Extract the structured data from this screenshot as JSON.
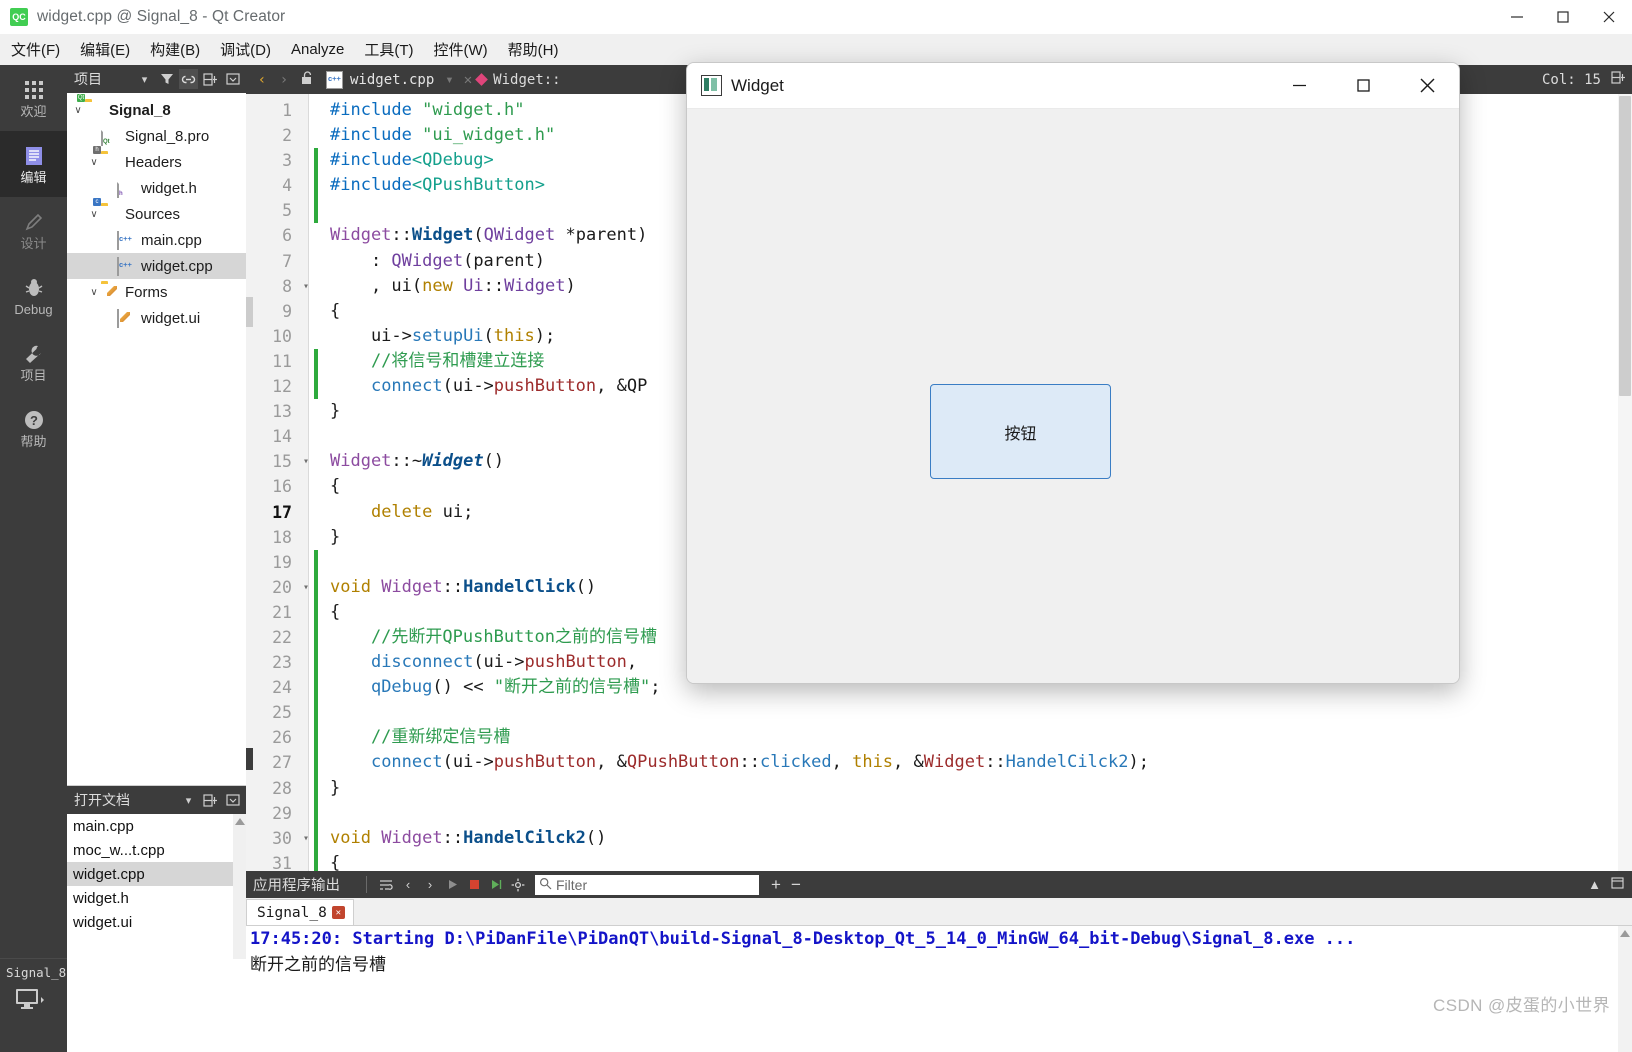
{
  "window": {
    "title": "widget.cpp @ Signal_8 - Qt Creator",
    "app_icon": "qt-logo-icon",
    "minimize_label": "—",
    "maximize_label": "☐",
    "close_label": "✕"
  },
  "menubar": {
    "items": [
      {
        "label": "文件(F)",
        "name": "menu-file"
      },
      {
        "label": "编辑(E)",
        "name": "menu-edit"
      },
      {
        "label": "构建(B)",
        "name": "menu-build"
      },
      {
        "label": "调试(D)",
        "name": "menu-debug"
      },
      {
        "label": "Analyze",
        "name": "menu-analyze"
      },
      {
        "label": "工具(T)",
        "name": "menu-tools"
      },
      {
        "label": "控件(W)",
        "name": "menu-window"
      },
      {
        "label": "帮助(H)",
        "name": "menu-help"
      }
    ]
  },
  "modebar": {
    "items": [
      {
        "label": "欢迎",
        "icon": "grid-icon",
        "active": false
      },
      {
        "label": "编辑",
        "icon": "document-icon",
        "active": true
      },
      {
        "label": "设计",
        "icon": "pencil-icon",
        "active": false
      },
      {
        "label": "Debug",
        "icon": "bug-icon",
        "active": false
      },
      {
        "label": "项目",
        "icon": "wrench-icon",
        "active": false
      },
      {
        "label": "帮助",
        "icon": "question-icon",
        "active": false
      }
    ],
    "kit_name": "Signal_8",
    "kit_icon": "desktop-icon"
  },
  "project_panel": {
    "title": "项目",
    "tools": [
      "chevron-down-icon",
      "filter-icon",
      "link-icon",
      "split-icon",
      "collapse-icon"
    ],
    "tree": [
      {
        "label": "Signal_8",
        "depth": 0,
        "arrow": "∨",
        "icon": "qt-project-folder-icon",
        "bold": true,
        "selected": false
      },
      {
        "label": "Signal_8.pro",
        "depth": 1,
        "arrow": "",
        "icon": "pro-file-icon",
        "bold": false,
        "selected": false
      },
      {
        "label": "Headers",
        "depth": 1,
        "arrow": "∨",
        "icon": "headers-folder-icon",
        "bold": false,
        "selected": false
      },
      {
        "label": "widget.h",
        "depth": 2,
        "arrow": "",
        "icon": "header-file-icon",
        "bold": false,
        "selected": false
      },
      {
        "label": "Sources",
        "depth": 1,
        "arrow": "∨",
        "icon": "sources-folder-icon",
        "bold": false,
        "selected": false
      },
      {
        "label": "main.cpp",
        "depth": 2,
        "arrow": "",
        "icon": "cpp-file-icon",
        "bold": false,
        "selected": false
      },
      {
        "label": "widget.cpp",
        "depth": 2,
        "arrow": "",
        "icon": "cpp-file-icon",
        "bold": false,
        "selected": true
      },
      {
        "label": "Forms",
        "depth": 1,
        "arrow": "∨",
        "icon": "forms-folder-icon",
        "bold": false,
        "selected": false
      },
      {
        "label": "widget.ui",
        "depth": 2,
        "arrow": "",
        "icon": "ui-file-icon",
        "bold": false,
        "selected": false
      }
    ]
  },
  "open_documents": {
    "title": "打开文档",
    "tools": [
      "chevron-down-icon",
      "split-icon",
      "collapse-icon"
    ],
    "items": [
      {
        "label": "main.cpp",
        "selected": false
      },
      {
        "label": "moc_w...t.cpp",
        "selected": false
      },
      {
        "label": "widget.cpp",
        "selected": true
      },
      {
        "label": "widget.h",
        "selected": false
      },
      {
        "label": "widget.ui",
        "selected": false
      }
    ]
  },
  "editor_toolbar": {
    "back_label": "‹",
    "forward_label": "›",
    "lock_icon": "unlocked-icon",
    "file_icon": "cpp-file-icon",
    "filename": "widget.cpp",
    "dropdown_label": "▾",
    "close_label": "✕",
    "symbol_icon": "class-diamond-icon",
    "symbol_name": "Widget::",
    "column_status": "Col: 15",
    "split_icon": "split-icon"
  },
  "code": {
    "lines": [
      {
        "n": "1",
        "fold": "",
        "changed": false,
        "cur": false,
        "tokens": [
          {
            "t": "#include ",
            "c": "k-pre"
          },
          {
            "t": "\"widget.h\"",
            "c": "k-str"
          }
        ]
      },
      {
        "n": "2",
        "fold": "",
        "changed": false,
        "cur": false,
        "tokens": [
          {
            "t": "#include ",
            "c": "k-pre"
          },
          {
            "t": "\"ui_widget.h\"",
            "c": "k-str"
          }
        ]
      },
      {
        "n": "3",
        "fold": "",
        "changed": true,
        "cur": false,
        "tokens": [
          {
            "t": "#include",
            "c": "k-pre"
          },
          {
            "t": "<QDebug>",
            "c": "k-hdr"
          }
        ]
      },
      {
        "n": "4",
        "fold": "",
        "changed": true,
        "cur": false,
        "tokens": [
          {
            "t": "#include",
            "c": "k-pre"
          },
          {
            "t": "<QPushButton>",
            "c": "k-hdr"
          }
        ]
      },
      {
        "n": "5",
        "fold": "",
        "changed": true,
        "cur": false,
        "tokens": [
          {
            "t": "",
            "c": "k-plain"
          }
        ]
      },
      {
        "n": "6",
        "fold": "",
        "changed": false,
        "cur": false,
        "tokens": [
          {
            "t": "Widget",
            "c": "k-cls"
          },
          {
            "t": "::",
            "c": "k-punc"
          },
          {
            "t": "Widget",
            "c": "k-fn"
          },
          {
            "t": "(",
            "c": "k-punc"
          },
          {
            "t": "QWidget",
            "c": "k-typ"
          },
          {
            "t": " *parent)",
            "c": "k-plain"
          }
        ]
      },
      {
        "n": "7",
        "fold": "",
        "changed": false,
        "cur": false,
        "tokens": [
          {
            "t": "    : ",
            "c": "k-plain"
          },
          {
            "t": "QWidget",
            "c": "k-typ"
          },
          {
            "t": "(parent)",
            "c": "k-plain"
          }
        ]
      },
      {
        "n": "8",
        "fold": "▾",
        "changed": false,
        "cur": false,
        "tokens": [
          {
            "t": "    , ",
            "c": "k-plain"
          },
          {
            "t": "ui",
            "c": "k-plain"
          },
          {
            "t": "(",
            "c": "k-punc"
          },
          {
            "t": "new ",
            "c": "k-kw"
          },
          {
            "t": "Ui",
            "c": "k-typ"
          },
          {
            "t": "::",
            "c": "k-punc"
          },
          {
            "t": "Widget",
            "c": "k-typ"
          },
          {
            "t": ")",
            "c": "k-punc"
          }
        ]
      },
      {
        "n": "9",
        "fold": "",
        "changed": false,
        "cur": false,
        "tokens": [
          {
            "t": "{",
            "c": "k-punc"
          }
        ]
      },
      {
        "n": "10",
        "fold": "",
        "changed": false,
        "cur": false,
        "tokens": [
          {
            "t": "    ui->",
            "c": "k-plain"
          },
          {
            "t": "setupUi",
            "c": "k-call"
          },
          {
            "t": "(",
            "c": "k-punc"
          },
          {
            "t": "this",
            "c": "k-kw"
          },
          {
            "t": ");",
            "c": "k-punc"
          }
        ]
      },
      {
        "n": "11",
        "fold": "",
        "changed": true,
        "cur": false,
        "tokens": [
          {
            "t": "    //将信号和槽建立连接",
            "c": "k-cmt"
          }
        ]
      },
      {
        "n": "12",
        "fold": "",
        "changed": true,
        "cur": false,
        "tokens": [
          {
            "t": "    ",
            "c": "k-plain"
          },
          {
            "t": "connect",
            "c": "k-call"
          },
          {
            "t": "(ui->",
            "c": "k-punc"
          },
          {
            "t": "pushButton",
            "c": "k-mem"
          },
          {
            "t": ", &QP",
            "c": "k-punc"
          }
        ]
      },
      {
        "n": "13",
        "fold": "",
        "changed": false,
        "cur": false,
        "tokens": [
          {
            "t": "}",
            "c": "k-punc"
          }
        ]
      },
      {
        "n": "14",
        "fold": "",
        "changed": false,
        "cur": false,
        "tokens": [
          {
            "t": "",
            "c": "k-plain"
          }
        ]
      },
      {
        "n": "15",
        "fold": "▾",
        "changed": false,
        "cur": false,
        "tokens": [
          {
            "t": "Widget",
            "c": "k-cls"
          },
          {
            "t": "::~",
            "c": "k-punc"
          },
          {
            "t": "Widget",
            "c": "k-fnit"
          },
          {
            "t": "()",
            "c": "k-punc"
          }
        ]
      },
      {
        "n": "16",
        "fold": "",
        "changed": false,
        "cur": false,
        "tokens": [
          {
            "t": "{",
            "c": "k-punc"
          }
        ]
      },
      {
        "n": "17",
        "fold": "",
        "changed": false,
        "cur": true,
        "tokens": [
          {
            "t": "    ",
            "c": "k-plain"
          },
          {
            "t": "delete ",
            "c": "k-kw"
          },
          {
            "t": "ui",
            "c": "k-plain"
          },
          {
            "t": ";",
            "c": "k-punc"
          }
        ]
      },
      {
        "n": "18",
        "fold": "",
        "changed": false,
        "cur": false,
        "tokens": [
          {
            "t": "}",
            "c": "k-punc"
          }
        ]
      },
      {
        "n": "19",
        "fold": "",
        "changed": true,
        "cur": false,
        "tokens": [
          {
            "t": "",
            "c": "k-plain"
          }
        ]
      },
      {
        "n": "20",
        "fold": "▾",
        "changed": true,
        "cur": false,
        "tokens": [
          {
            "t": "void ",
            "c": "k-kw"
          },
          {
            "t": "Widget",
            "c": "k-cls"
          },
          {
            "t": "::",
            "c": "k-punc"
          },
          {
            "t": "HandelClick",
            "c": "k-fn"
          },
          {
            "t": "()",
            "c": "k-punc"
          }
        ]
      },
      {
        "n": "21",
        "fold": "",
        "changed": true,
        "cur": false,
        "tokens": [
          {
            "t": "{",
            "c": "k-punc"
          }
        ]
      },
      {
        "n": "22",
        "fold": "",
        "changed": true,
        "cur": false,
        "tokens": [
          {
            "t": "    //先断开QPushButton之前的信号槽",
            "c": "k-cmt"
          }
        ]
      },
      {
        "n": "23",
        "fold": "",
        "changed": true,
        "cur": false,
        "tokens": [
          {
            "t": "    ",
            "c": "k-plain"
          },
          {
            "t": "disconnect",
            "c": "k-call"
          },
          {
            "t": "(ui->",
            "c": "k-punc"
          },
          {
            "t": "pushButton",
            "c": "k-mem"
          },
          {
            "t": ", ",
            "c": "k-punc"
          }
        ]
      },
      {
        "n": "24",
        "fold": "",
        "changed": true,
        "cur": false,
        "tokens": [
          {
            "t": "    ",
            "c": "k-plain"
          },
          {
            "t": "qDebug",
            "c": "k-call"
          },
          {
            "t": "() ",
            "c": "k-punc"
          },
          {
            "t": "<< ",
            "c": "k-punc"
          },
          {
            "t": "\"断开之前的信号槽\"",
            "c": "k-str"
          },
          {
            "t": ";",
            "c": "k-punc"
          }
        ]
      },
      {
        "n": "25",
        "fold": "",
        "changed": true,
        "cur": false,
        "tokens": [
          {
            "t": "",
            "c": "k-plain"
          }
        ]
      },
      {
        "n": "26",
        "fold": "",
        "changed": true,
        "cur": false,
        "tokens": [
          {
            "t": "    //重新绑定信号槽",
            "c": "k-cmt"
          }
        ]
      },
      {
        "n": "27",
        "fold": "",
        "changed": true,
        "cur": false,
        "tokens": [
          {
            "t": "    ",
            "c": "k-plain"
          },
          {
            "t": "connect",
            "c": "k-call"
          },
          {
            "t": "(ui->",
            "c": "k-punc"
          },
          {
            "t": "pushButton",
            "c": "k-mem"
          },
          {
            "t": ", &",
            "c": "k-punc"
          },
          {
            "t": "QPushButton",
            "c": "k-mem"
          },
          {
            "t": "::",
            "c": "k-punc"
          },
          {
            "t": "clicked",
            "c": "k-call"
          },
          {
            "t": ", ",
            "c": "k-punc"
          },
          {
            "t": "this",
            "c": "k-kw"
          },
          {
            "t": ", &",
            "c": "k-punc"
          },
          {
            "t": "Widget",
            "c": "k-mem"
          },
          {
            "t": "::",
            "c": "k-punc"
          },
          {
            "t": "HandelCilck2",
            "c": "k-call"
          },
          {
            "t": ");",
            "c": "k-punc"
          }
        ]
      },
      {
        "n": "28",
        "fold": "",
        "changed": true,
        "cur": false,
        "tokens": [
          {
            "t": "}",
            "c": "k-punc"
          }
        ]
      },
      {
        "n": "29",
        "fold": "",
        "changed": true,
        "cur": false,
        "tokens": [
          {
            "t": "",
            "c": "k-plain"
          }
        ]
      },
      {
        "n": "30",
        "fold": "▾",
        "changed": true,
        "cur": false,
        "tokens": [
          {
            "t": "void ",
            "c": "k-kw"
          },
          {
            "t": "Widget",
            "c": "k-cls"
          },
          {
            "t": "::",
            "c": "k-punc"
          },
          {
            "t": "HandelCilck2",
            "c": "k-fn"
          },
          {
            "t": "()",
            "c": "k-punc"
          }
        ]
      },
      {
        "n": "31",
        "fold": "",
        "changed": true,
        "cur": false,
        "tokens": [
          {
            "t": "{",
            "c": "k-punc"
          }
        ]
      }
    ]
  },
  "output_pane": {
    "title": "应用程序输出",
    "icons": [
      "wrap-lines-icon",
      "prev-item-icon",
      "next-item-icon",
      "run-icon",
      "stop-icon",
      "rerun-icon",
      "settings-icon"
    ],
    "filter_placeholder": "Filter",
    "filter_value": "",
    "search_icon": "search-icon",
    "zoom_in_label": "+",
    "zoom_out_label": "−",
    "maximize_icon": "chevron-up-icon",
    "close_icon": "close-pane-icon",
    "tab": {
      "label": "Signal_8",
      "close_label": "✕"
    },
    "lines": [
      {
        "text": "17:45:20: Starting D:\\PiDanFile\\PiDanQT\\build-Signal_8-Desktop_Qt_5_14_0_MinGW_64_bit-Debug\\Signal_8.exe ...",
        "style": "blue"
      },
      {
        "text": "断开之前的信号槽",
        "style": "black"
      }
    ]
  },
  "widget_dialog": {
    "title": "Widget",
    "icon": "qt-widget-icon",
    "minimize_label": "—",
    "maximize_label": "☐",
    "close_label": "✕",
    "button_label": "按钮"
  },
  "watermark": {
    "text": "CSDN @皮蛋的小世界"
  },
  "colors": {
    "chrome_dark": "#3c3c3c",
    "accent_green": "#41cd52",
    "changed_marker": "#2eaa3d",
    "selection_gray": "#d6d6d6",
    "output_blue": "#1414c8",
    "button_border": "#3a7dc4",
    "button_fill": "#ddeaf7"
  }
}
